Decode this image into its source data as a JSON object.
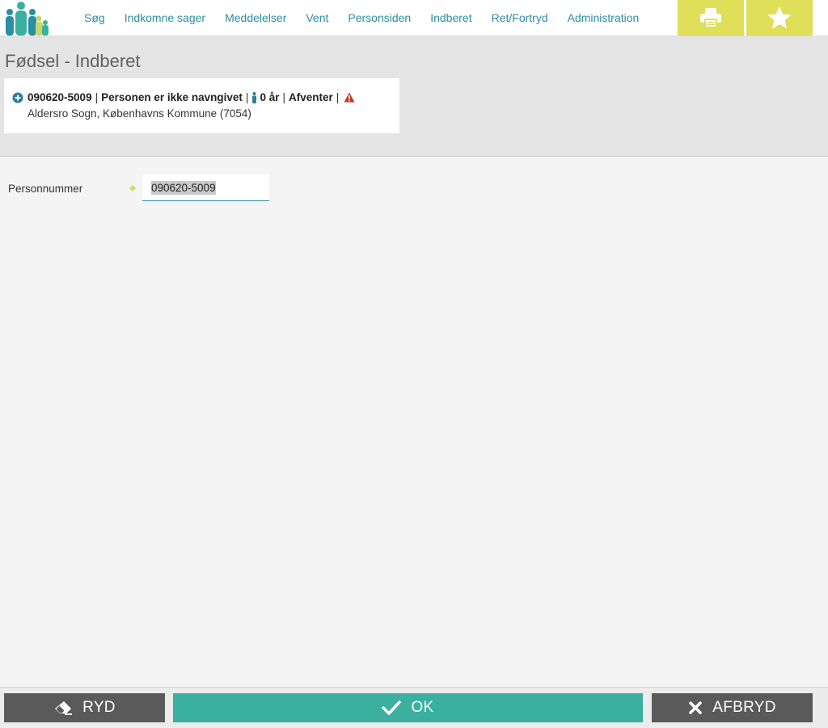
{
  "nav": {
    "items": [
      {
        "label": "Søg"
      },
      {
        "label": "Indkomne sager"
      },
      {
        "label": "Meddelelser"
      },
      {
        "label": "Vent"
      },
      {
        "label": "Personsiden"
      },
      {
        "label": "Indberet"
      },
      {
        "label": "Ret/Fortryd"
      },
      {
        "label": "Administration"
      }
    ],
    "tools": {
      "print_icon": "printer-icon",
      "favorite_icon": "star-icon"
    }
  },
  "page": {
    "title": "Fødsel - Indberet"
  },
  "person": {
    "cpr": "090620-5009",
    "name": "Personen er ikke navngivet",
    "age": "0 år",
    "status": "Afventer",
    "separator": "|",
    "address": "Aldersro Sogn, Københavns Kommune (7054)"
  },
  "form": {
    "personnummer_label": "Personnummer",
    "personnummer_value": "090620-5009"
  },
  "footer": {
    "ryd_label": "RYD",
    "ok_label": "OK",
    "afbryd_label": "AFBRYD"
  },
  "colors": {
    "nav_text": "#2a8fa0",
    "tool_yellow": "#dfdf5a",
    "ok_green": "#3bb0a0",
    "button_gray": "#5a5a5a",
    "warning_red": "#c0392b"
  }
}
